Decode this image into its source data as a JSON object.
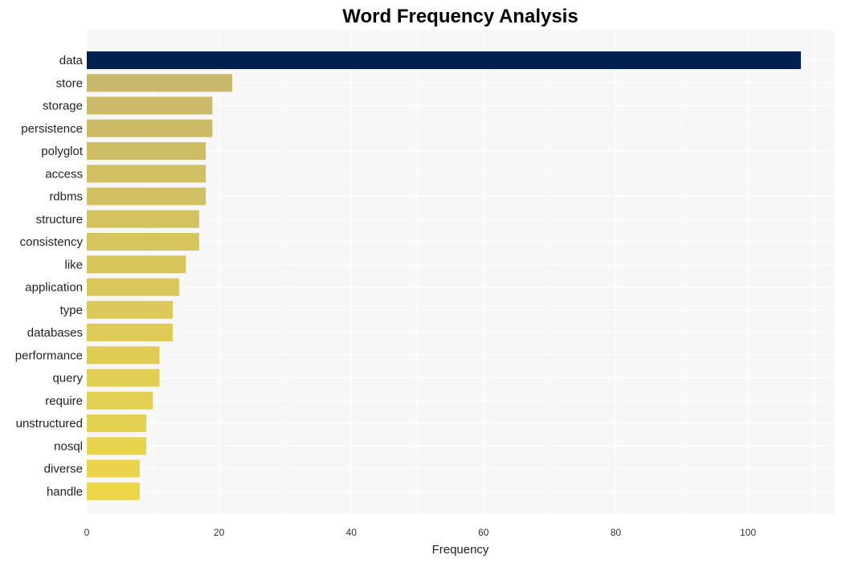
{
  "chart_data": {
    "type": "bar",
    "orientation": "horizontal",
    "title": "Word Frequency Analysis",
    "xlabel": "Frequency",
    "ylabel": "",
    "xlim": [
      0,
      113
    ],
    "xticks": [
      0,
      20,
      40,
      60,
      80,
      100
    ],
    "grid": true,
    "categories": [
      "data",
      "store",
      "storage",
      "persistence",
      "polyglot",
      "access",
      "rdbms",
      "structure",
      "consistency",
      "like",
      "application",
      "type",
      "databases",
      "performance",
      "query",
      "require",
      "unstructured",
      "nosql",
      "diverse",
      "handle"
    ],
    "values": [
      108,
      22,
      19,
      19,
      18,
      18,
      18,
      17,
      17,
      15,
      14,
      13,
      13,
      11,
      11,
      10,
      9,
      9,
      8,
      8
    ],
    "colors": {
      "highlight": "#00214d",
      "gradient_start": "#c9b86b",
      "gradient_end": "#ebd64a",
      "plot_background": "#f7f7f7",
      "grid": "#ffffff"
    }
  }
}
